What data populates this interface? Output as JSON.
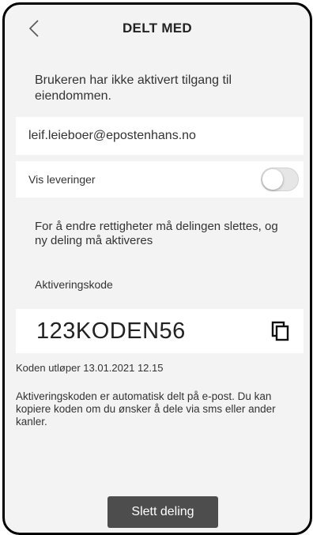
{
  "header": {
    "title": "DELT MED",
    "back_icon": "chevron-left-icon"
  },
  "notice": "Brukeren har ikke aktivert tilgang til eiendommen.",
  "email": "leif.leieboer@epostenhans.no",
  "deliveries": {
    "label": "Vis leveringer",
    "enabled": false
  },
  "info": "For å endre rettigheter må delingen slettes, og ny deling må aktiveres",
  "activation": {
    "label": "Aktiveringskode",
    "code": "123KODEN56",
    "copy_icon": "copy-icon",
    "expiry": "Koden utløper 13.01.2021 12.15",
    "description": "Aktiveringskoden er automatisk delt på e-post. Du kan kopiere koden om du ønsker å dele via sms eller ander kanler."
  },
  "delete_button": "Slett deling",
  "colors": {
    "background": "#f3f3f3",
    "card": "#ffffff",
    "button": "#4d4d4d",
    "toggle_off": "#e6e6e6"
  }
}
